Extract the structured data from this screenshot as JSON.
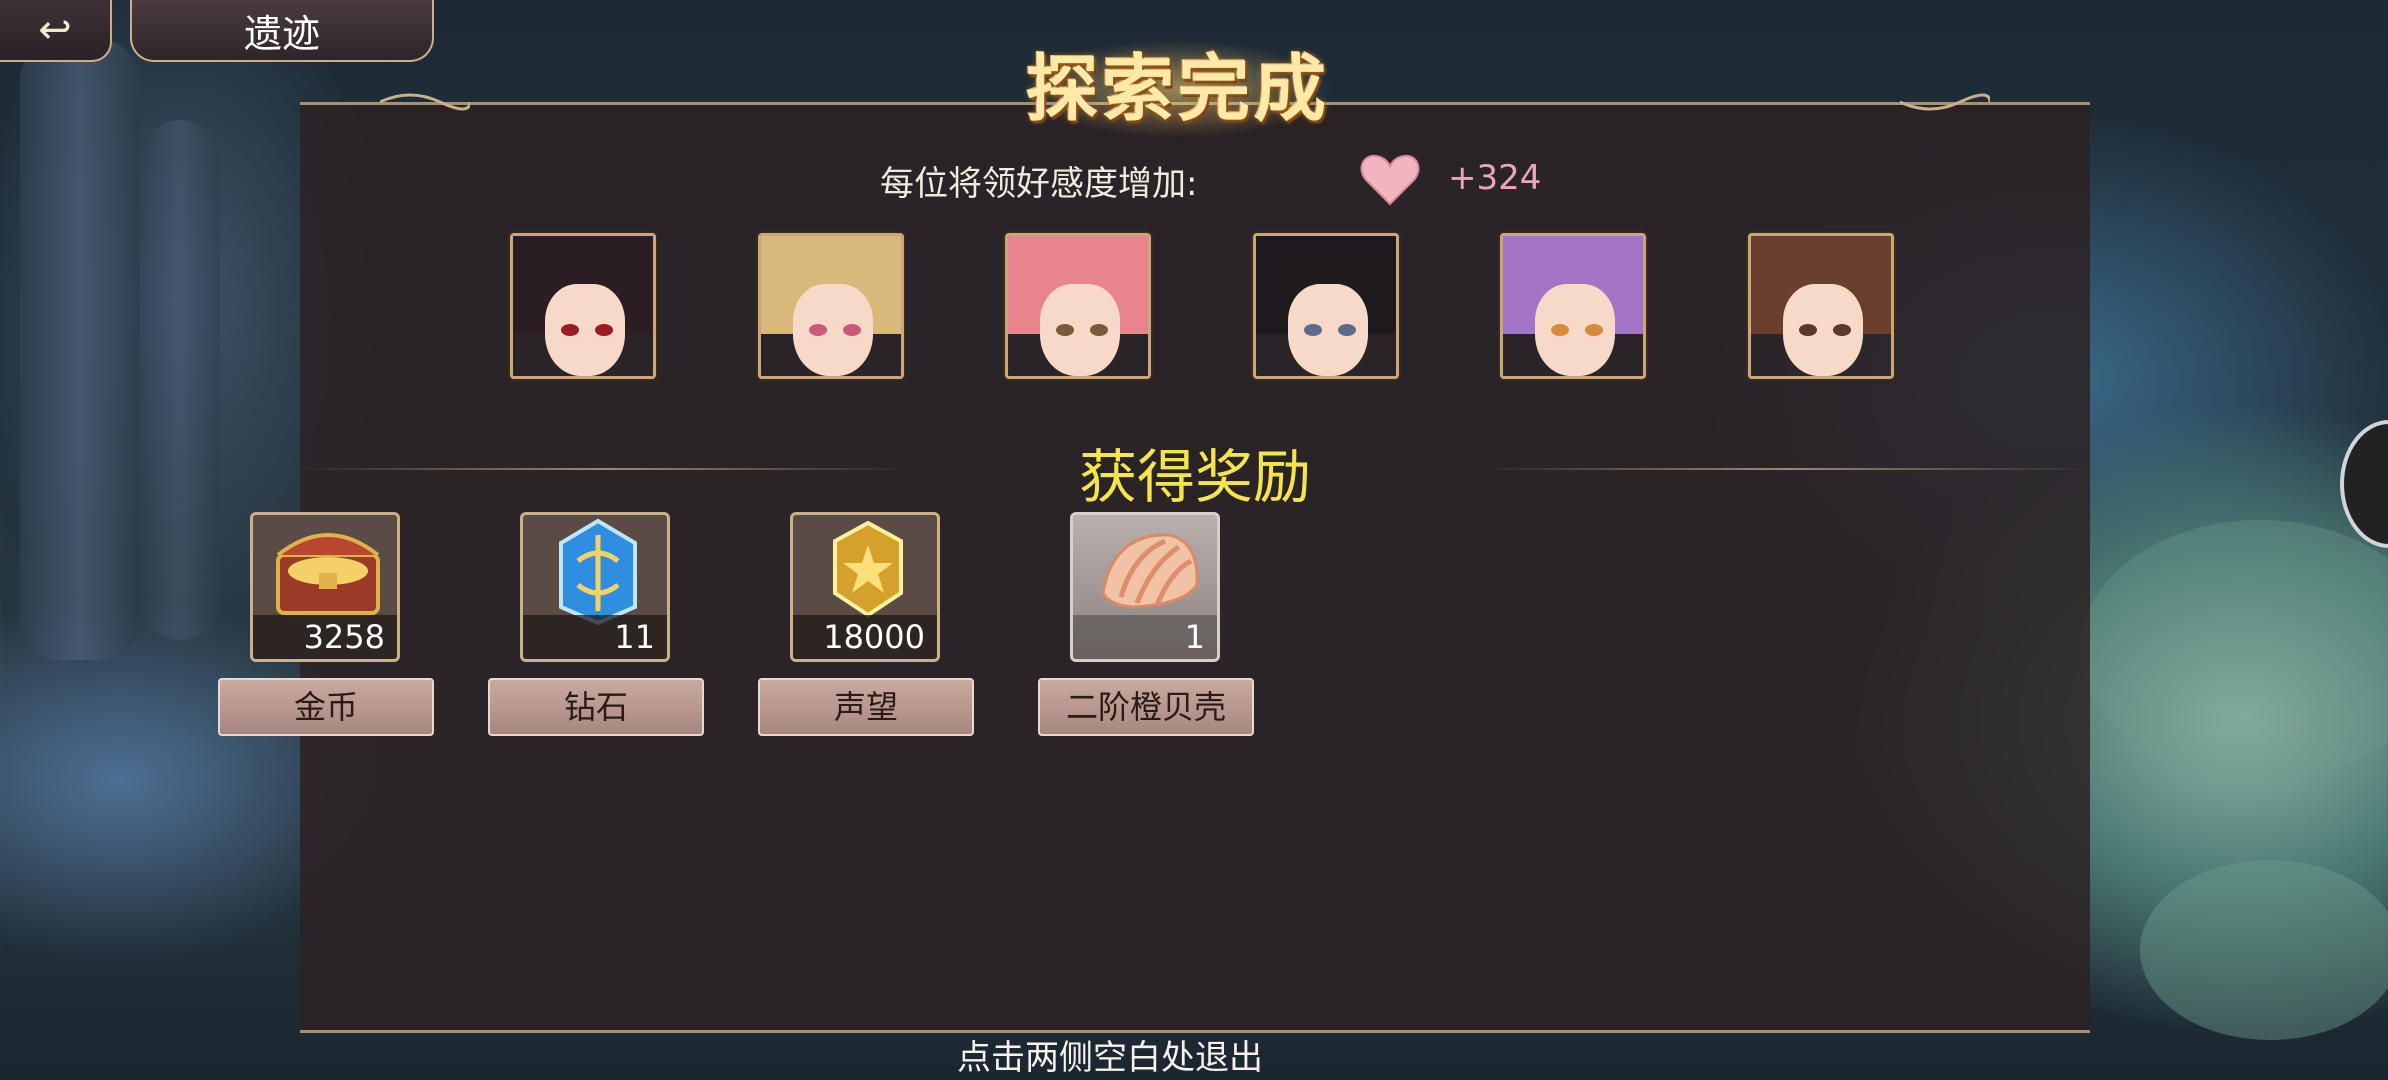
{
  "header": {
    "back_icon": "back-arrow-icon",
    "title": "遗迹"
  },
  "banner": {
    "title": "探索完成"
  },
  "affinity": {
    "label": "每位将领好感度增加:",
    "icon": "heart-icon",
    "value": "+324",
    "color": "#e8a7b3"
  },
  "portraits": [
    {
      "name": "portrait-1",
      "hair": "#2a1e22",
      "accent": "#b4242f",
      "eyes": "#9d1c22"
    },
    {
      "name": "portrait-2",
      "hair": "#d9b87c",
      "accent": "#7aa9d9",
      "eyes": "#c95a7a"
    },
    {
      "name": "portrait-3",
      "hair": "#e8858b",
      "accent": "#f3c9d0",
      "eyes": "#7a5a3a"
    },
    {
      "name": "portrait-4",
      "hair": "#1e1a1e",
      "accent": "#c43a57",
      "eyes": "#5a6c8a"
    },
    {
      "name": "portrait-5",
      "hair": "#a474c6",
      "accent": "#e4a9d0",
      "eyes": "#d68a3a"
    },
    {
      "name": "portrait-6",
      "hair": "#6a3f2e",
      "accent": "#2a2a2a",
      "eyes": "#5a3a2a"
    }
  ],
  "rewards": {
    "title": "获得奖励",
    "items": [
      {
        "label": "金币",
        "qty": "3258",
        "icon": "treasure-chest-icon"
      },
      {
        "label": "钻石",
        "qty": "11",
        "icon": "blue-crystal-icon"
      },
      {
        "label": "声望",
        "qty": "18000",
        "icon": "gold-badge-icon"
      },
      {
        "label": "二阶橙贝壳",
        "qty": "1",
        "icon": "orange-shell-icon"
      }
    ]
  },
  "footer": {
    "hint": "点击两侧空白处退出"
  },
  "colors": {
    "reward_title": "#f4e64a",
    "panel_border": "#a8926e"
  }
}
